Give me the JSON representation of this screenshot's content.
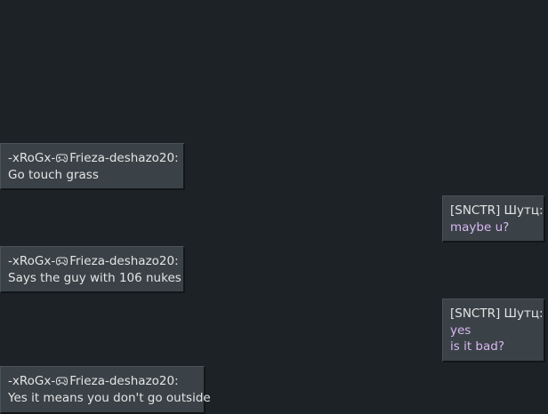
{
  "colors": {
    "background": "#1d2226",
    "bubble": "#3a4247",
    "incoming_text": "#e4e4e4",
    "outgoing_text": "#d9b6f2"
  },
  "messages": [
    {
      "direction": "incoming",
      "sender_prefix": "-xRoGx-",
      "sender_icon": "gamepad-icon",
      "sender_name": "Frieza-deshazo20:",
      "lines": [
        "Go touch grass"
      ]
    },
    {
      "direction": "outgoing",
      "sender": "[SNCTR] Шутц:",
      "lines": [
        "maybe u?"
      ]
    },
    {
      "direction": "incoming",
      "sender_prefix": "-xRoGx-",
      "sender_icon": "gamepad-icon",
      "sender_name": "Frieza-deshazo20:",
      "lines": [
        "Says the guy with 106 nukes"
      ]
    },
    {
      "direction": "outgoing",
      "sender": "[SNCTR] Шутц:",
      "lines": [
        "yes",
        "is it bad?"
      ]
    },
    {
      "direction": "incoming",
      "sender_prefix": "-xRoGx-",
      "sender_icon": "gamepad-icon",
      "sender_name": "Frieza-deshazo20:",
      "lines": [
        "Yes it means you don't go outside"
      ]
    }
  ]
}
